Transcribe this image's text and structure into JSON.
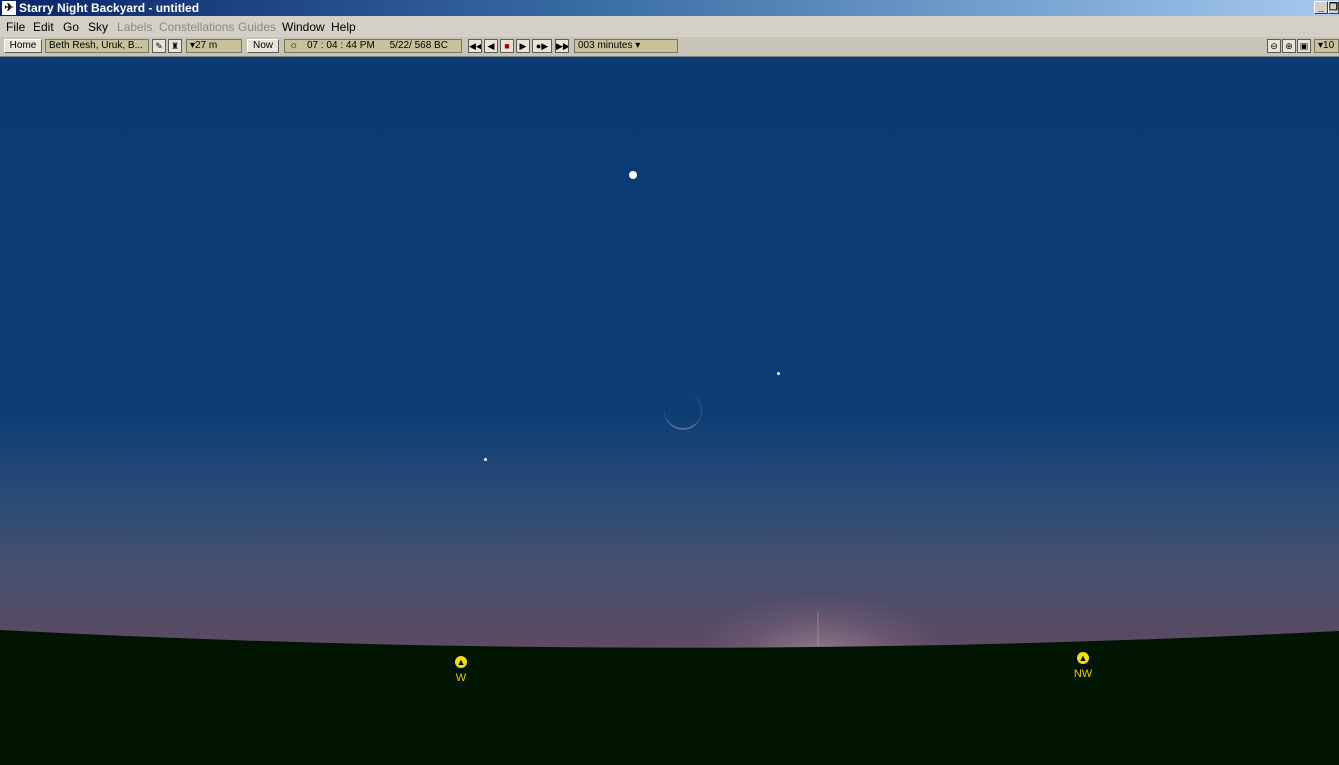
{
  "window": {
    "title": "Starry Night Backyard - untitled",
    "minimize_glyph": "_",
    "restore_glyph": "❐"
  },
  "menu": {
    "items": [
      {
        "label": "File",
        "enabled": true
      },
      {
        "label": "Edit",
        "enabled": true
      },
      {
        "label": "Go",
        "enabled": true
      },
      {
        "label": "Sky",
        "enabled": true
      },
      {
        "label": "Labels",
        "enabled": false
      },
      {
        "label": "Constellations",
        "enabled": false
      },
      {
        "label": "Guides",
        "enabled": false
      },
      {
        "label": "Window",
        "enabled": true
      },
      {
        "label": "Help",
        "enabled": true
      }
    ]
  },
  "toolbar": {
    "home_label": "Home",
    "location": "Beth Resh, Uruk, B...",
    "elevation": "▾27 m",
    "now_label": "Now",
    "time": "07 : 04 : 44 PM",
    "date": "5/22/  568 BC",
    "time_step": "003 minutes ▾",
    "zoom_value": "▾10"
  },
  "sky": {
    "compass": [
      {
        "label": "W"
      },
      {
        "label": "NW"
      }
    ]
  },
  "colors": {
    "sky_top": "#0a3a72",
    "horizon": "#6b5160",
    "ground": "#021402",
    "compass_marker": "#f2e000"
  }
}
